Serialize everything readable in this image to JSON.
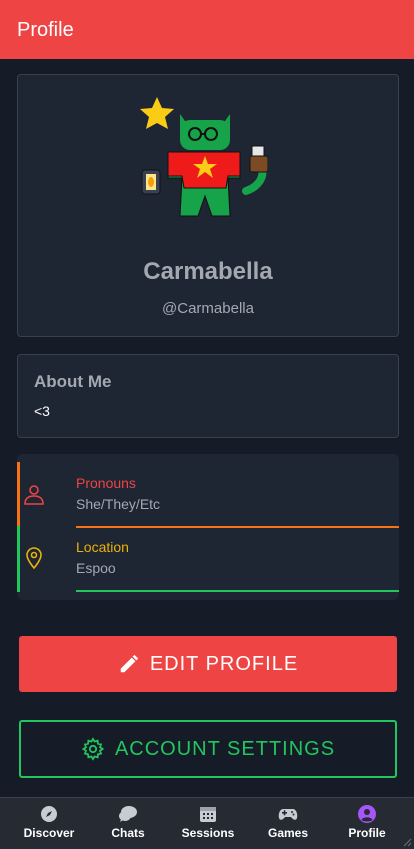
{
  "header": {
    "title": "Profile"
  },
  "profile": {
    "display_name": "Carmabella",
    "handle": "@Carmabella"
  },
  "about": {
    "title": "About Me",
    "body": "<3"
  },
  "info": [
    {
      "label": "Pronouns",
      "value": "She/They/Etc",
      "icon": "person-icon",
      "color": "#ef4444"
    },
    {
      "label": "Location",
      "value": "Espoo",
      "icon": "map-pin-icon",
      "color": "#eab308"
    }
  ],
  "buttons": {
    "edit": "EDIT PROFILE",
    "settings": "ACCOUNT SETTINGS"
  },
  "nav": [
    {
      "label": "Discover",
      "icon": "compass-icon"
    },
    {
      "label": "Chats",
      "icon": "chat-bubble-icon"
    },
    {
      "label": "Sessions",
      "icon": "calendar-icon"
    },
    {
      "label": "Games",
      "icon": "gamepad-icon"
    },
    {
      "label": "Profile",
      "icon": "user-circle-icon",
      "active": true
    }
  ],
  "colors": {
    "accent": "#ef4444",
    "success": "#22c55e",
    "warning": "#eab308",
    "orange": "#f97316",
    "active_nav": "#a855f7"
  }
}
